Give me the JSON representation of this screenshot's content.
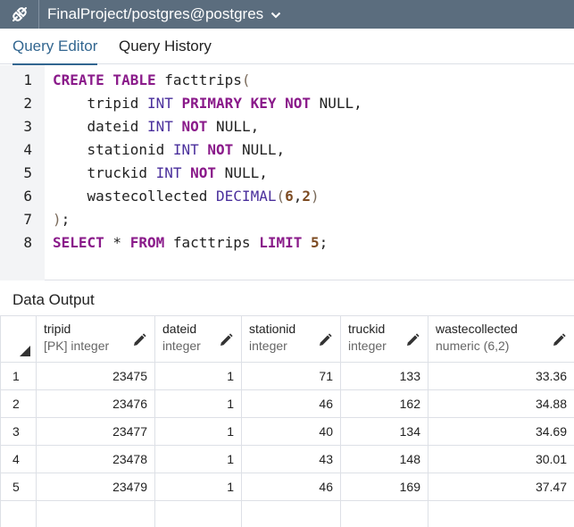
{
  "connection": {
    "title": "FinalProject/postgres@postgres",
    "icon": "plug-icon"
  },
  "tabs": [
    {
      "label": "Query Editor",
      "active": true
    },
    {
      "label": "Query History",
      "active": false
    }
  ],
  "editor": {
    "line_numbers": [
      "1",
      "2",
      "3",
      "4",
      "5",
      "6",
      "7",
      "8"
    ],
    "lines": [
      [
        {
          "t": "CREATE TABLE",
          "c": "kw"
        },
        {
          "t": " facttrips",
          "c": ""
        },
        {
          "t": "(",
          "c": "pn"
        }
      ],
      [
        {
          "t": "    tripid ",
          "c": ""
        },
        {
          "t": "INT",
          "c": "ty"
        },
        {
          "t": " ",
          "c": ""
        },
        {
          "t": "PRIMARY KEY NOT",
          "c": "kw"
        },
        {
          "t": " NULL,",
          "c": ""
        }
      ],
      [
        {
          "t": "    dateid ",
          "c": ""
        },
        {
          "t": "INT",
          "c": "ty"
        },
        {
          "t": " ",
          "c": ""
        },
        {
          "t": "NOT",
          "c": "kw"
        },
        {
          "t": " NULL,",
          "c": ""
        }
      ],
      [
        {
          "t": "    stationid ",
          "c": ""
        },
        {
          "t": "INT",
          "c": "ty"
        },
        {
          "t": " ",
          "c": ""
        },
        {
          "t": "NOT",
          "c": "kw"
        },
        {
          "t": " NULL,",
          "c": ""
        }
      ],
      [
        {
          "t": "    truckid ",
          "c": ""
        },
        {
          "t": "INT",
          "c": "ty"
        },
        {
          "t": " ",
          "c": ""
        },
        {
          "t": "NOT",
          "c": "kw"
        },
        {
          "t": " NULL,",
          "c": ""
        }
      ],
      [
        {
          "t": "    wastecollected ",
          "c": ""
        },
        {
          "t": "DECIMAL",
          "c": "fn"
        },
        {
          "t": "(",
          "c": "pn"
        },
        {
          "t": "6",
          "c": "num"
        },
        {
          "t": ",",
          "c": ""
        },
        {
          "t": "2",
          "c": "num"
        },
        {
          "t": ")",
          "c": "pn"
        }
      ],
      [
        {
          "t": ")",
          "c": "pn"
        },
        {
          "t": ";",
          "c": ""
        }
      ],
      [
        {
          "t": "SELECT",
          "c": "kw"
        },
        {
          "t": " * ",
          "c": ""
        },
        {
          "t": "FROM",
          "c": "kw"
        },
        {
          "t": " facttrips ",
          "c": ""
        },
        {
          "t": "LIMIT",
          "c": "kw"
        },
        {
          "t": " ",
          "c": ""
        },
        {
          "t": "5",
          "c": "num"
        },
        {
          "t": ";",
          "c": ""
        }
      ]
    ]
  },
  "output": {
    "label": "Data Output",
    "columns": [
      {
        "name": "tripid",
        "type": "[PK] integer"
      },
      {
        "name": "dateid",
        "type": "integer"
      },
      {
        "name": "stationid",
        "type": "integer"
      },
      {
        "name": "truckid",
        "type": "integer"
      },
      {
        "name": "wastecollected",
        "type": "numeric (6,2)"
      }
    ],
    "rows": [
      {
        "n": "1",
        "cells": [
          "23475",
          "1",
          "71",
          "133",
          "33.36"
        ]
      },
      {
        "n": "2",
        "cells": [
          "23476",
          "1",
          "46",
          "162",
          "34.88"
        ]
      },
      {
        "n": "3",
        "cells": [
          "23477",
          "1",
          "40",
          "134",
          "34.69"
        ]
      },
      {
        "n": "4",
        "cells": [
          "23478",
          "1",
          "43",
          "148",
          "30.01"
        ]
      },
      {
        "n": "5",
        "cells": [
          "23479",
          "1",
          "46",
          "169",
          "37.47"
        ]
      }
    ]
  },
  "colors": {
    "titlebar": "#5b6d7e",
    "accent": "#326690",
    "keyword": "#8a1a8a",
    "type": "#4a2f9c",
    "number": "#7d4b22"
  }
}
